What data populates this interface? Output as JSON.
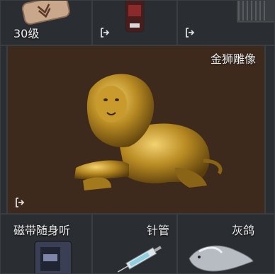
{
  "inventory": {
    "top_row": [
      {
        "level": "30级",
        "item_icon": "badge-icon"
      },
      {
        "item_icon": "bottle-icon",
        "action_icon": "exit-icon"
      },
      {
        "item_icon": "unknown-item",
        "action_icon": "exit-icon"
      }
    ],
    "featured_item": {
      "name": "金狮雕像",
      "icon": "golden-lion-statue",
      "action_icon": "exit-icon",
      "highlight_color": "#3e2a1c"
    },
    "bottom_row": [
      {
        "name": "磁带随身听",
        "icon": "cassette-player-icon"
      },
      {
        "name": "针管",
        "icon": "syringe-icon"
      },
      {
        "name": "灰鸽",
        "icon": "grey-pigeon-icon"
      }
    ]
  }
}
